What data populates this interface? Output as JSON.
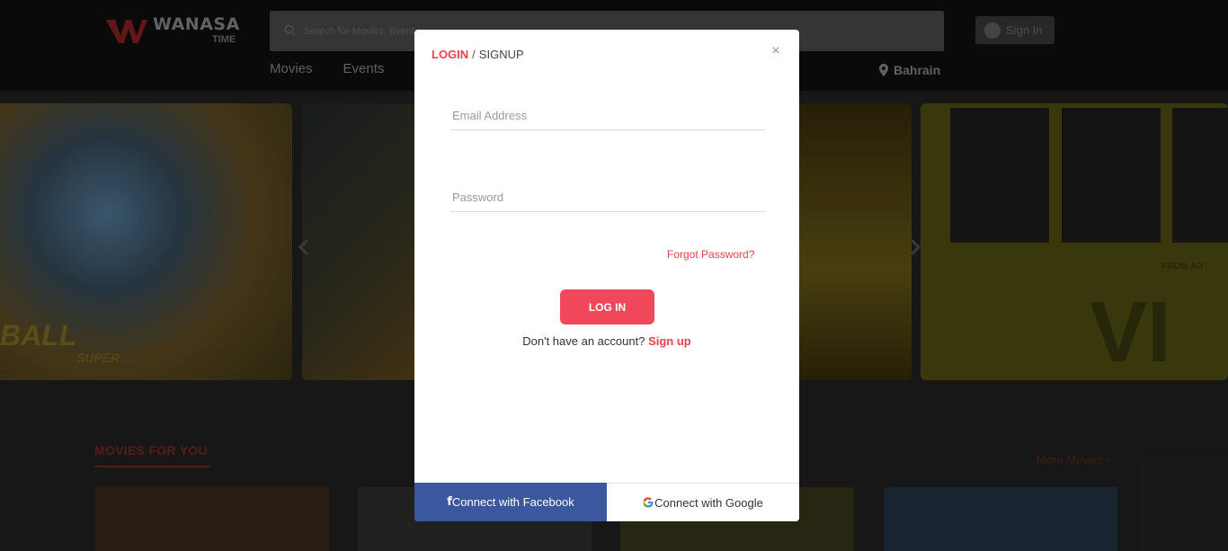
{
  "header": {
    "logo_text": "WANASA",
    "logo_subtext": "TIME",
    "search_placeholder": "Search for Movies, Events",
    "signin_label": "Sign In",
    "nav": [
      "Movies",
      "Events"
    ],
    "location": "Bahrain"
  },
  "carousel": {
    "slide1_title": "BALL",
    "slide1_subtitle": "SUPER",
    "slide4_text": "FROM AD",
    "slide4_big": "VI"
  },
  "section": {
    "title": "MOVIES FOR YOU",
    "more_link": "More Movies ›"
  },
  "modal": {
    "tab_login": "LOGIN",
    "tab_separator": "/",
    "tab_signup": "SIGNUP",
    "close_symbol": "×",
    "email_placeholder": "Email Address",
    "password_placeholder": "Password",
    "forgot_password": "Forgot Password?",
    "login_button": "LOG IN",
    "no_account_text": "Don't have an account?",
    "signup_link": "Sign up",
    "facebook_icon": "f",
    "facebook_button": "Connect with Facebook",
    "google_button": "Connect with Google"
  },
  "colors": {
    "accent": "#e8414b",
    "login_button": "#f0485a",
    "facebook": "#3b579d"
  },
  "icons": [
    "search-icon",
    "user-icon",
    "map-pin-icon",
    "close-icon",
    "facebook-icon",
    "google-icon",
    "chevron-left-icon",
    "chevron-right-icon"
  ]
}
